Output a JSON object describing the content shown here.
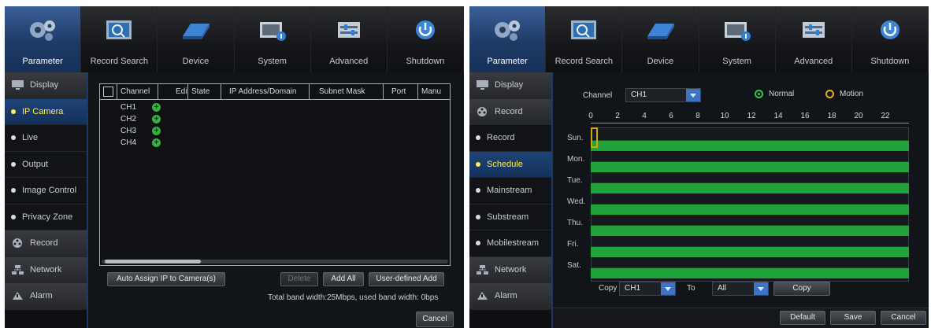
{
  "tabs": [
    {
      "label": "Parameter",
      "icon": "gears-icon"
    },
    {
      "label": "Record Search",
      "icon": "record-search-icon"
    },
    {
      "label": "Device",
      "icon": "hard-drive-icon"
    },
    {
      "label": "System",
      "icon": "system-info-icon"
    },
    {
      "label": "Advanced",
      "icon": "advanced-settings-icon"
    },
    {
      "label": "Shutdown",
      "icon": "power-icon"
    }
  ],
  "left": {
    "sidebar": [
      {
        "label": "Display",
        "type": "group"
      },
      {
        "label": "IP Camera",
        "type": "sub",
        "active": true
      },
      {
        "label": "Live",
        "type": "sub"
      },
      {
        "label": "Output",
        "type": "sub"
      },
      {
        "label": "Image Control",
        "type": "sub"
      },
      {
        "label": "Privacy Zone",
        "type": "sub"
      },
      {
        "label": "Record",
        "type": "group"
      },
      {
        "label": "Network",
        "type": "group"
      },
      {
        "label": "Alarm",
        "type": "group"
      }
    ],
    "table": {
      "columns": [
        "Channel",
        "Edit",
        "State",
        "IP Address/Domain",
        "Subnet Mask",
        "Port",
        "Manu"
      ],
      "rows": [
        "CH1",
        "CH2",
        "CH3",
        "CH4"
      ]
    },
    "buttons": {
      "auto_assign": "Auto Assign IP to Camera(s)",
      "delete": "Delete",
      "add_all": "Add All",
      "user_defined_add": "User-defined Add",
      "cancel": "Cancel"
    },
    "bandwidth_text": "Total band width:25Mbps, used band width: 0bps"
  },
  "right": {
    "sidebar": [
      {
        "label": "Display",
        "type": "group"
      },
      {
        "label": "Record",
        "type": "group"
      },
      {
        "label": "Record",
        "type": "sub"
      },
      {
        "label": "Schedule",
        "type": "sub",
        "active": true
      },
      {
        "label": "Mainstream",
        "type": "sub"
      },
      {
        "label": "Substream",
        "type": "sub"
      },
      {
        "label": "Mobilestream",
        "type": "sub"
      },
      {
        "label": "Network",
        "type": "group"
      },
      {
        "label": "Alarm",
        "type": "group"
      }
    ],
    "channel_label": "Channel",
    "channel_value": "CH1",
    "mode_normal": "Normal",
    "mode_motion": "Motion",
    "selected_mode": "Normal",
    "hours": [
      "0",
      "2",
      "4",
      "6",
      "8",
      "10",
      "12",
      "14",
      "16",
      "18",
      "20",
      "22"
    ],
    "days": [
      "Sun.",
      "Mon.",
      "Tue.",
      "Wed.",
      "Thu.",
      "Fri.",
      "Sat."
    ],
    "copy_label": "Copy",
    "copy_from": "CH1",
    "to_label": "To",
    "copy_to": "All",
    "copy_button": "Copy",
    "footer_buttons": {
      "default": "Default",
      "save": "Save",
      "cancel": "Cancel"
    }
  },
  "colors": {
    "schedule_normal": "#1fa33a",
    "active_tab": "#1e3a66",
    "active_text": "#ffee55",
    "motion_radio": "#e6b300"
  }
}
